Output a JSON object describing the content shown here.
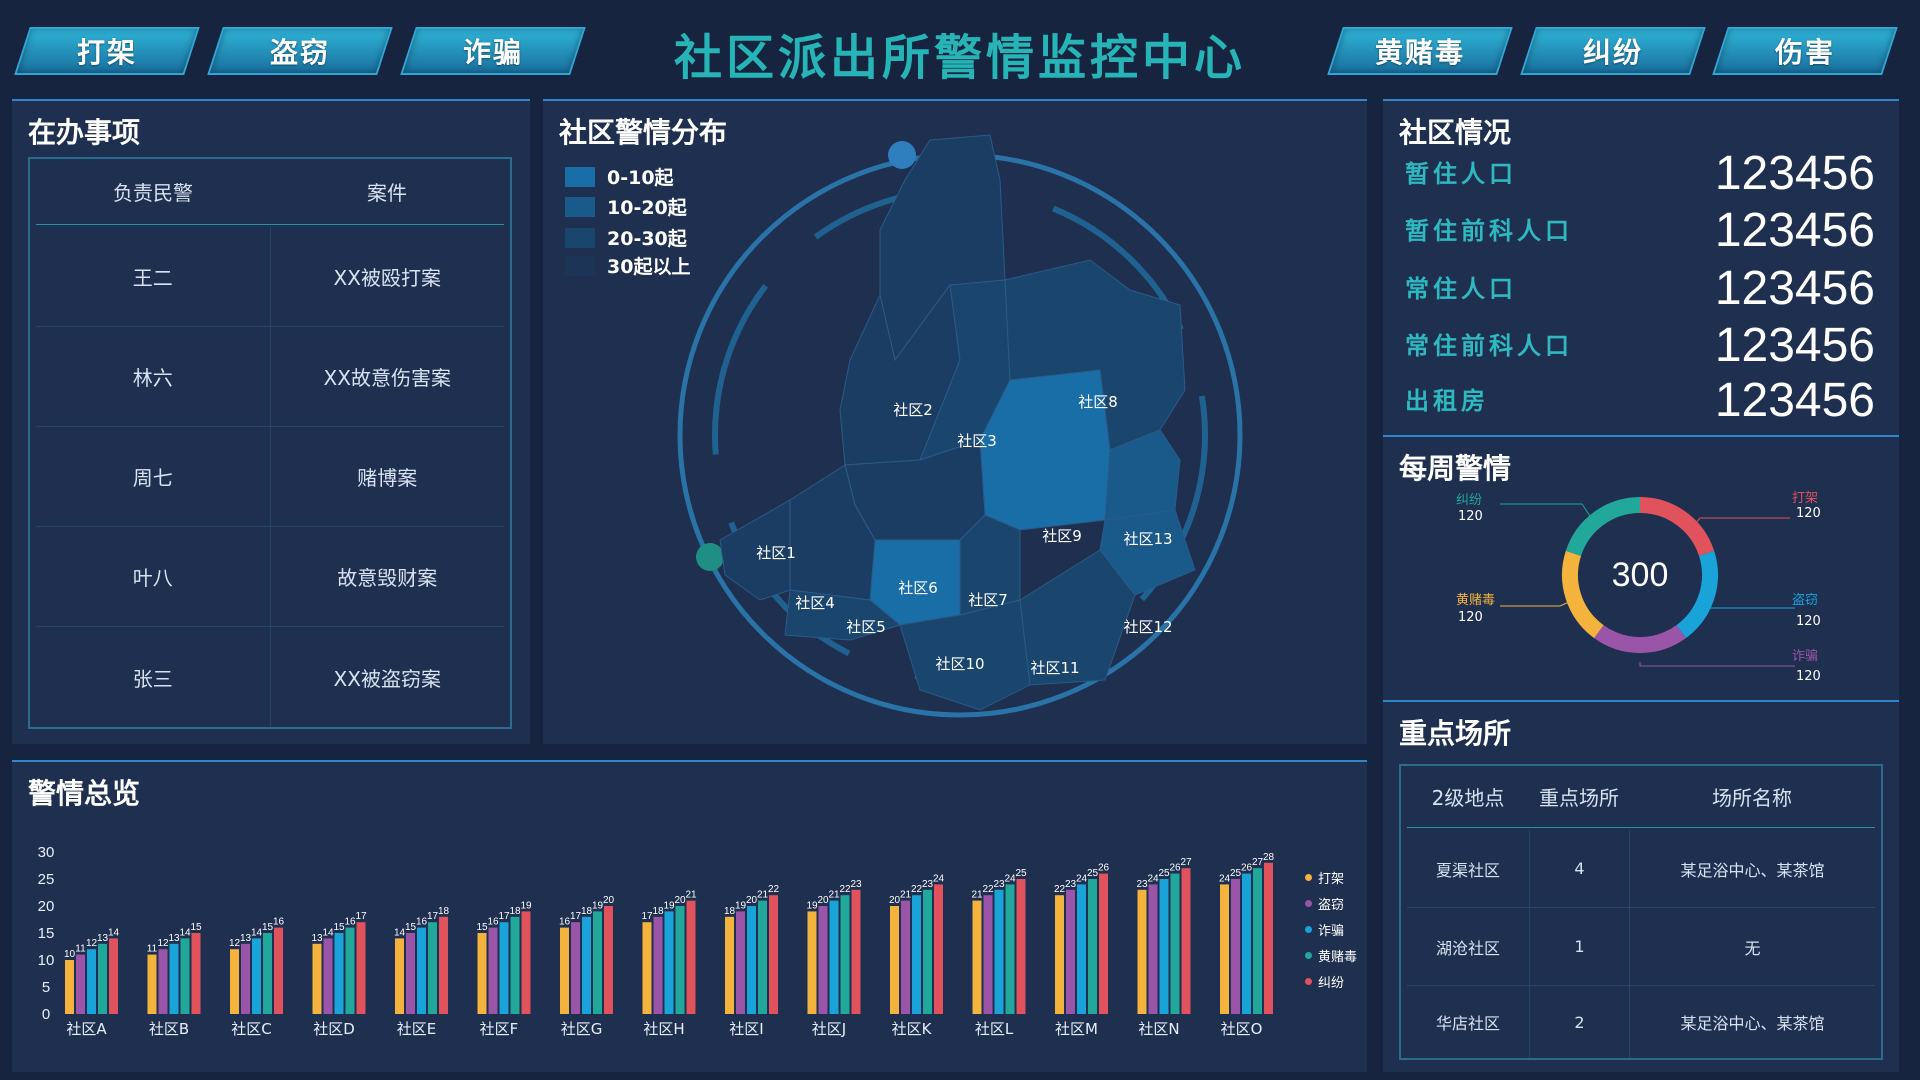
{
  "header": {
    "title": "社区派出所警情监控中心",
    "nav_left": [
      "打架",
      "盗窃",
      "诈骗"
    ],
    "nav_right": [
      "黄赌毒",
      "纠纷",
      "伤害"
    ]
  },
  "pending": {
    "title": "在办事项",
    "columns": [
      "负责民警",
      "案件"
    ],
    "rows": [
      [
        "王二",
        "XX被殴打案"
      ],
      [
        "林六",
        "XX故意伤害案"
      ],
      [
        "周七",
        "赌博案"
      ],
      [
        "叶八",
        "故意毁财案"
      ],
      [
        "张三",
        "XX被盗窃案"
      ]
    ]
  },
  "distribution": {
    "title": "社区警情分布",
    "legend": [
      {
        "label": "0-10起",
        "color": "#1a6ea8"
      },
      {
        "label": "10-20起",
        "color": "#1a5a8a"
      },
      {
        "label": "20-30起",
        "color": "#1a466e"
      },
      {
        "label": "30起以上",
        "color": "#1c3557"
      }
    ],
    "regions": [
      "社区1",
      "社区2",
      "社区3",
      "社区4",
      "社区5",
      "社区6",
      "社区7",
      "社区8",
      "社区9",
      "社区10",
      "社区11",
      "社区12",
      "社区13"
    ]
  },
  "community": {
    "title": "社区情况",
    "stats": [
      {
        "label": "暂住人口",
        "value": "123456"
      },
      {
        "label": "暂住前科人口",
        "value": "123456"
      },
      {
        "label": "常住人口",
        "value": "123456"
      },
      {
        "label": "常住前科人口",
        "value": "123456"
      },
      {
        "label": "出租房",
        "value": "123456"
      }
    ]
  },
  "weekly": {
    "title": "每周警情",
    "total": "300",
    "segments": [
      {
        "name": "打架",
        "value": 120,
        "color": "#e0525c"
      },
      {
        "name": "盗窃",
        "value": 120,
        "color": "#1aa3d8"
      },
      {
        "name": "诈骗",
        "value": 120,
        "color": "#9b55a8"
      },
      {
        "name": "黄赌毒",
        "value": 120,
        "color": "#f3b33d"
      },
      {
        "name": "纠纷",
        "value": 120,
        "color": "#21a89a"
      }
    ]
  },
  "key_places": {
    "title": "重点场所",
    "columns": [
      "2级地点",
      "重点场所",
      "场所名称"
    ],
    "rows": [
      [
        "夏渠社区",
        "4",
        "某足浴中心、某茶馆"
      ],
      [
        "湖沧社区",
        "1",
        "无"
      ],
      [
        "华店社区",
        "2",
        "某足浴中心、某茶馆"
      ]
    ]
  },
  "overview": {
    "title": "警情总览"
  },
  "chart_data": {
    "type": "bar",
    "categories": [
      "社区A",
      "社区B",
      "社区C",
      "社区D",
      "社区E",
      "社区F",
      "社区G",
      "社区H",
      "社区I",
      "社区J",
      "社区K",
      "社区L",
      "社区M",
      "社区N",
      "社区O"
    ],
    "series": [
      {
        "name": "打架",
        "color": "#f3b33d",
        "values": [
          10,
          11,
          12,
          13,
          14,
          15,
          16,
          17,
          18,
          19,
          20,
          21,
          22,
          23,
          24
        ]
      },
      {
        "name": "盗窃",
        "color": "#9b55a8",
        "values": [
          11,
          12,
          13,
          14,
          15,
          16,
          17,
          18,
          19,
          20,
          21,
          22,
          23,
          24,
          25
        ]
      },
      {
        "name": "诈骗",
        "color": "#1aa3d8",
        "values": [
          12,
          13,
          14,
          15,
          16,
          17,
          18,
          19,
          20,
          21,
          22,
          23,
          24,
          25,
          26
        ]
      },
      {
        "name": "黄赌毒",
        "color": "#21a89a",
        "values": [
          13,
          14,
          15,
          16,
          17,
          18,
          19,
          20,
          21,
          22,
          23,
          24,
          25,
          26,
          27
        ]
      },
      {
        "name": "纠纷",
        "color": "#e0525c",
        "values": [
          14,
          15,
          16,
          17,
          18,
          19,
          20,
          21,
          22,
          23,
          24,
          25,
          26,
          27,
          28
        ]
      }
    ],
    "yticks": [
      "0",
      "5",
      "10",
      "15",
      "20",
      "25",
      "30"
    ],
    "ylim": [
      0,
      30
    ],
    "legend_position": "right",
    "grid": false
  }
}
